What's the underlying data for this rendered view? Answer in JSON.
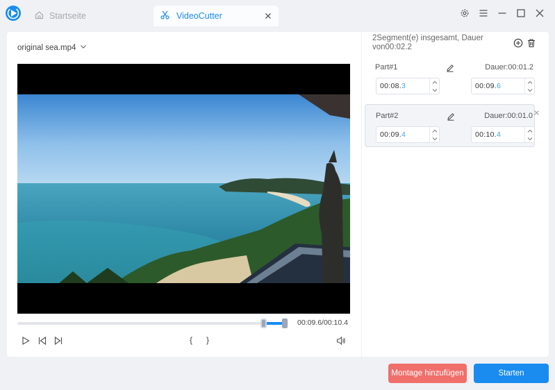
{
  "titlebar": {
    "tabs": [
      {
        "label": "Startseite",
        "icon": "home-icon"
      },
      {
        "label": "VideoCutter",
        "icon": "scissors-icon"
      }
    ]
  },
  "player": {
    "file_name": "original sea.mp4",
    "time_readout": "00:09.6/00:10.4",
    "mark_in": "{",
    "mark_out": "}",
    "progress_fraction": 0.92
  },
  "segments": {
    "summary": "2Segment(e) insgesamt, Dauer von00:02.2",
    "parts": [
      {
        "title": "Part#1",
        "duration": "Dauer:00:01.2",
        "start_main": "00:08.",
        "start_ms": "3",
        "end_main": "00:09.",
        "end_ms": "6"
      },
      {
        "title": "Part#2",
        "duration": "Dauer:00:01.0",
        "start_main": "00:09.",
        "start_ms": "4",
        "end_main": "00:10.",
        "end_ms": "4"
      }
    ]
  },
  "buttons": {
    "montage": "Montage hinzufügen",
    "start": "Starten"
  },
  "colors": {
    "accent": "#1a8cf0",
    "montage": "#f06f6a"
  }
}
